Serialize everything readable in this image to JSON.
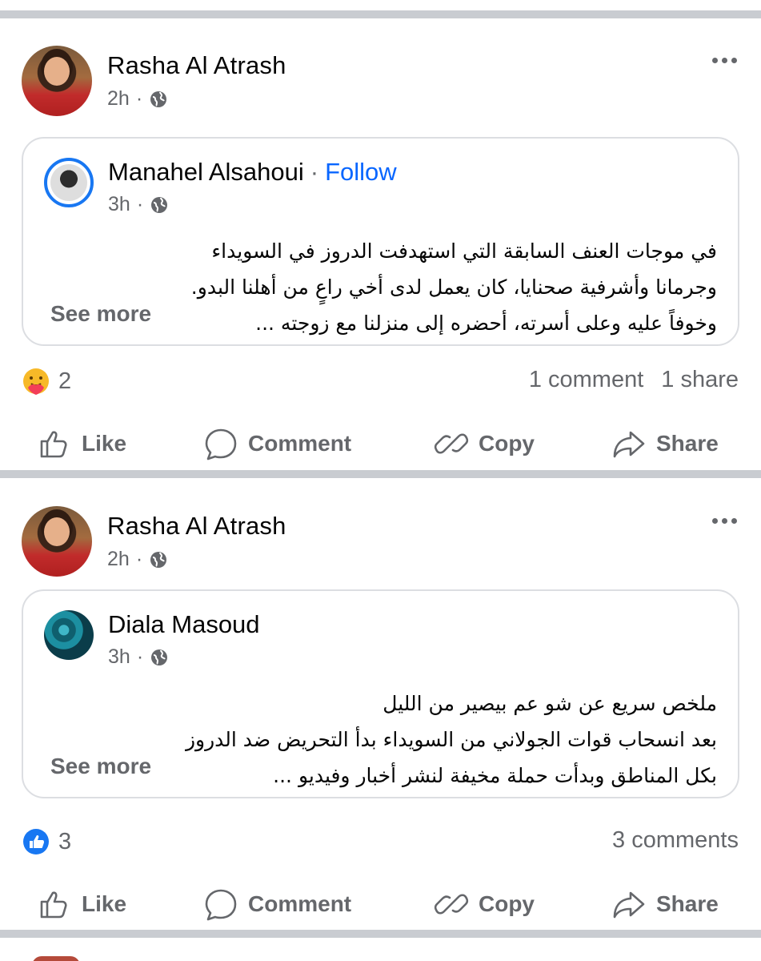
{
  "posts": [
    {
      "author": "Rasha Al Atrash",
      "time": "2h",
      "shared": {
        "author": "Manahel Alsahoui",
        "separator": "·",
        "follow": "Follow",
        "time": "3h",
        "lines": [
          "في موجات العنف السابقة التي استهدفت الدروز في السويداء",
          "وجرمانا وأشرفية صحنايا، كان يعمل لدى أخي راعٍ من أهلنا البدو.",
          "وخوفاً عليه وعلى أسرته، أحضره إلى منزلنا مع زوجته ..."
        ],
        "see_more": "See more"
      },
      "reaction_icon": "care-reaction-icon",
      "reaction_count": "2",
      "comments": "1 comment",
      "shares": "1 share"
    },
    {
      "author": "Rasha Al Atrash",
      "time": "2h",
      "shared": {
        "author": "Diala Masoud",
        "separator": "",
        "follow": "",
        "time": "3h",
        "lines": [
          "ملخص سريع عن شو عم بيصير من الليل",
          "بعد انسحاب قوات الجولاني من السويداء بدأ التحريض ضد الدروز",
          "بكل المناطق وبدأت حملة مخيفة لنشر أخبار وفيديو ..."
        ],
        "see_more": "See more"
      },
      "reaction_icon": "like-reaction-icon",
      "reaction_count": "3",
      "comments": "3 comments",
      "shares": ""
    }
  ],
  "actions": {
    "like": "Like",
    "comment": "Comment",
    "copy": "Copy",
    "share": "Share"
  },
  "colors": {
    "accent": "#0866ff",
    "muted": "#65676b",
    "separator": "#c9ccd1",
    "card_border": "#dcdee2"
  }
}
